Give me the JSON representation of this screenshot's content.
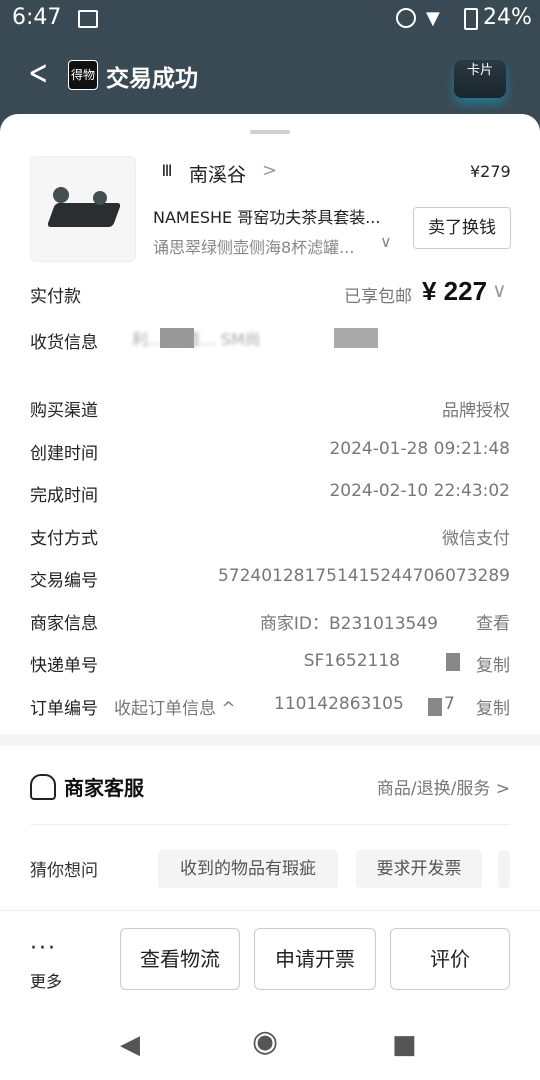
{
  "status_bar": {
    "time": "6:47",
    "battery": "24%"
  },
  "header": {
    "title": "交易成功",
    "logo_text": "得物",
    "card_label": "卡片"
  },
  "product": {
    "shop_name": "南溪谷",
    "price": "¥279",
    "title": "NAMESHE 哥窑功夫茶具套装...",
    "spec": "诵思翠绿侧壶侧海8杯滤罐...",
    "sell_button": "卖了换钱"
  },
  "order": {
    "paid_label": "实付款",
    "shipping_note": "已享包邮",
    "paid_amount": "¥ 227",
    "address_label": "收货信息",
    "address_value": "利... 街道... SM尚",
    "channel_label": "购买渠道",
    "channel_value": "品牌授权",
    "created_label": "创建时间",
    "created_value": "2024-01-28 09:21:48",
    "completed_label": "完成时间",
    "completed_value": "2024-02-10 22:43:02",
    "payment_label": "支付方式",
    "payment_value": "微信支付",
    "trade_label": "交易编号",
    "trade_value": "57240128175141524470607328​9",
    "merchant_label": "商家信息",
    "merchant_value": "商家ID：B231013549",
    "merchant_link": "查看",
    "express_label": "快递单号",
    "express_value": "SF1652118",
    "express_link": "复制",
    "ordernum_label": "订单编号",
    "ordernum_toggle": "收起订单信息 ^",
    "ordernum_value": "110142863105",
    "ordernum_tail": "7",
    "ordernum_link": "复制"
  },
  "service": {
    "title": "商家客服",
    "links": "商品/退换/服务"
  },
  "guess": {
    "label": "猜你想问",
    "chips": [
      "收到的物品有瑕疵",
      "要求开发票"
    ]
  },
  "actions": {
    "more": "更多",
    "more_dots": "···",
    "buttons": [
      "查看物流",
      "申请开票",
      "评价"
    ]
  }
}
